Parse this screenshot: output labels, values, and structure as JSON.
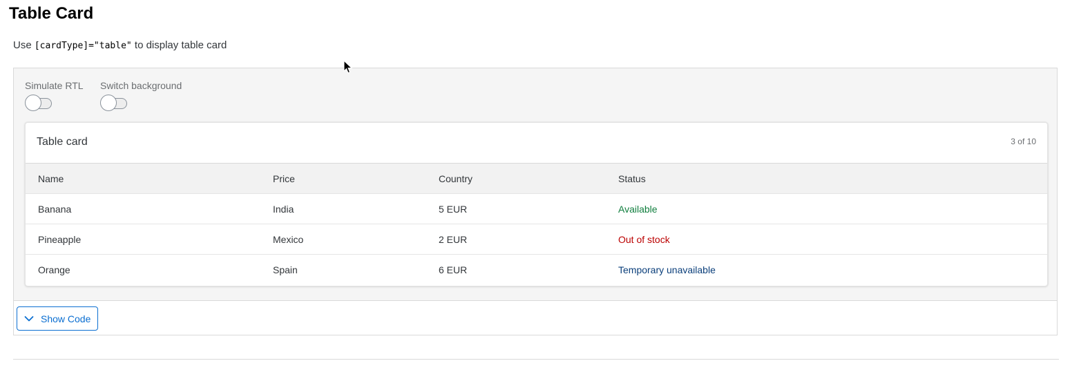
{
  "page": {
    "title": "Table Card",
    "description_prefix": "Use ",
    "description_code": "[cardType]=\"table\"",
    "description_suffix": " to display table card"
  },
  "switches": [
    {
      "label": "Simulate RTL",
      "checked": false
    },
    {
      "label": "Switch background",
      "checked": false
    }
  ],
  "card": {
    "title": "Table card",
    "counter": "3 of 10",
    "columns": [
      "Name",
      "Price",
      "Country",
      "Status"
    ],
    "rows": [
      {
        "cells": [
          "Banana",
          "India",
          "5 EUR",
          "Available"
        ],
        "status_type": "success"
      },
      {
        "cells": [
          "Pineapple",
          "Mexico",
          "2 EUR",
          "Out of stock"
        ],
        "status_type": "error"
      },
      {
        "cells": [
          "Orange",
          "Spain",
          "6 EUR",
          "Temporary unavailable"
        ],
        "status_type": "info"
      }
    ]
  },
  "actions": {
    "show_code_label": "Show Code",
    "show_code_icon": "chevron-down-icon"
  },
  "colors": {
    "accent": "#0a6ed1",
    "success": "#107e3e",
    "error": "#bb0000",
    "info": "#0a3e7a"
  }
}
